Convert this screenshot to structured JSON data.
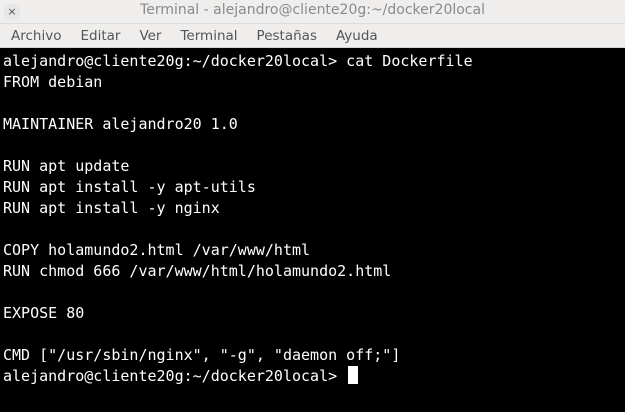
{
  "window": {
    "title": "Terminal - alejandro@cliente20g:~/docker20local",
    "close_glyph": "×"
  },
  "menu": {
    "items": [
      {
        "label": "Archivo"
      },
      {
        "label": "Editar"
      },
      {
        "label": "Ver"
      },
      {
        "label": "Terminal"
      },
      {
        "label": "Pestañas"
      },
      {
        "label": "Ayuda"
      }
    ]
  },
  "terminal": {
    "lines": [
      "alejandro@cliente20g:~/docker20local> cat Dockerfile",
      "FROM debian",
      "",
      "MAINTAINER alejandro20 1.0",
      "",
      "RUN apt update",
      "RUN apt install -y apt-utils",
      "RUN apt install -y nginx",
      "",
      "COPY holamundo2.html /var/www/html",
      "RUN chmod 666 /var/www/html/holamundo2.html",
      "",
      "EXPOSE 80",
      "",
      "CMD [\"/usr/sbin/nginx\", \"-g\", \"daemon off;\"]"
    ],
    "prompt": "alejandro@cliente20g:~/docker20local> "
  },
  "colors": {
    "terminal_background": "#000000",
    "terminal_foreground": "#ffffff",
    "chrome_background": "#efeeed"
  }
}
